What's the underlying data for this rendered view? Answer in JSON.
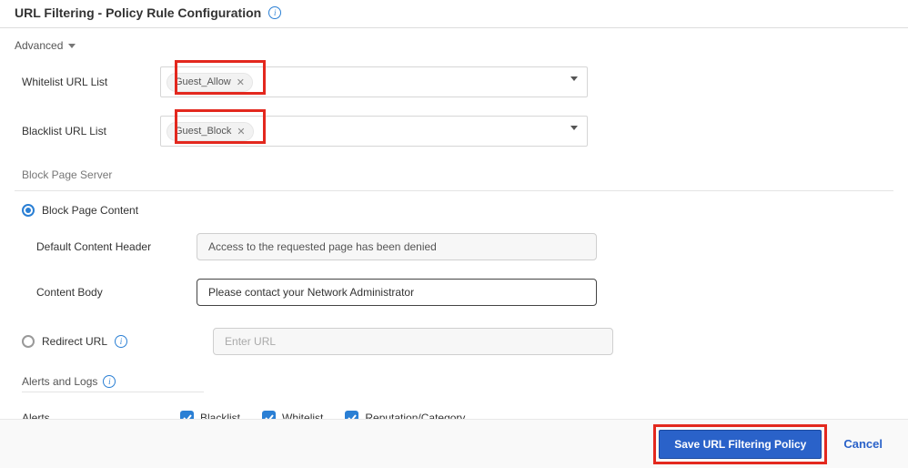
{
  "header": {
    "title": "URL Filtering - Policy Rule Configuration"
  },
  "advanced": {
    "label": "Advanced"
  },
  "whitelist": {
    "label": "Whitelist URL List",
    "chip": "Guest_Allow"
  },
  "blacklist": {
    "label": "Blacklist URL List",
    "chip": "Guest_Block"
  },
  "blockPageServer": {
    "label": "Block Page Server"
  },
  "blockPageContent": {
    "radio_label": "Block Page Content",
    "default_header_label": "Default Content Header",
    "default_header_value": "Access to the requested page has been denied",
    "body_label": "Content Body",
    "body_value": "Please contact your Network Administrator"
  },
  "redirect": {
    "radio_label": "Redirect URL",
    "placeholder": "Enter URL"
  },
  "alertsLogs": {
    "label": "Alerts and Logs"
  },
  "alerts": {
    "label": "Alerts",
    "cb1": "Blacklist",
    "cb2": "Whitelist",
    "cb3": "Reputation/Category"
  },
  "footer": {
    "save": "Save URL Filtering Policy",
    "cancel": "Cancel"
  }
}
